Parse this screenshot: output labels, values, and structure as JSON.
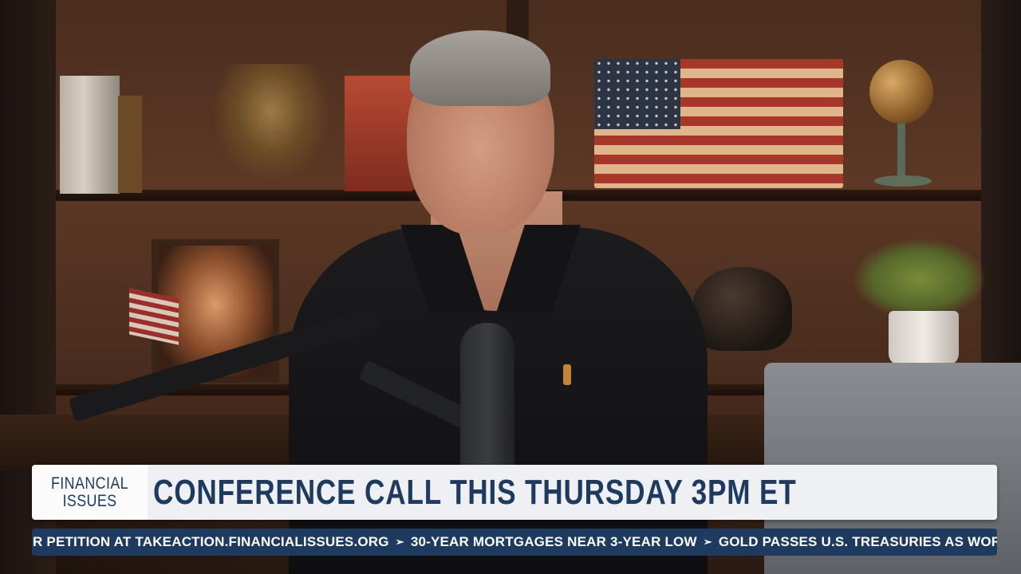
{
  "lower_third": {
    "brand_line1": "FINANCIAL",
    "brand_line2": "ISSUES",
    "headline": "CONFERENCE CALL THIS THURSDAY 3PM ET"
  },
  "ticker": {
    "items": [
      "R PETITION AT TAKEACTION.FINANCIALISSUES.ORG",
      "30-YEAR MORTGAGES NEAR 3-YEAR LOW",
      "GOLD PASSES U.S. TREASURIES AS WORLD’S LAR"
    ],
    "separator": "➢"
  },
  "colors": {
    "brand_navy": "#1f3a5f",
    "lower_third_bg": "#fbfbfc",
    "ticker_text": "#ffffff"
  }
}
